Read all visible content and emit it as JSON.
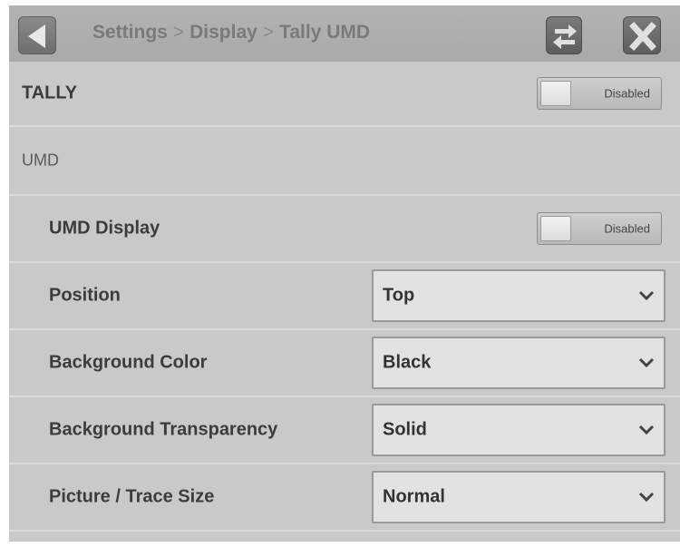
{
  "header": {
    "breadcrumb": [
      "Settings",
      "Display",
      "Tally UMD"
    ],
    "separator": ">"
  },
  "tally": {
    "label": "TALLY",
    "toggle_state": "Disabled"
  },
  "umd_section": {
    "label": "UMD"
  },
  "umd_display": {
    "label": "UMD Display",
    "toggle_state": "Disabled"
  },
  "settings": [
    {
      "label": "Position",
      "value": "Top"
    },
    {
      "label": "Background Color",
      "value": "Black"
    },
    {
      "label": "Background Transparency",
      "value": "Solid"
    },
    {
      "label": "Picture / Trace Size",
      "value": "Normal"
    }
  ],
  "icons": {
    "back": "back-arrow-icon",
    "swap": "swap-arrows-icon",
    "close": "close-x-icon",
    "dropdown": "chevron-down-icon"
  },
  "colors": {
    "panel_bg": "#c9c9c9",
    "header_bg": "#ababab",
    "button_dark": "#6e6e6e",
    "text_dark": "#3c3c3c"
  }
}
